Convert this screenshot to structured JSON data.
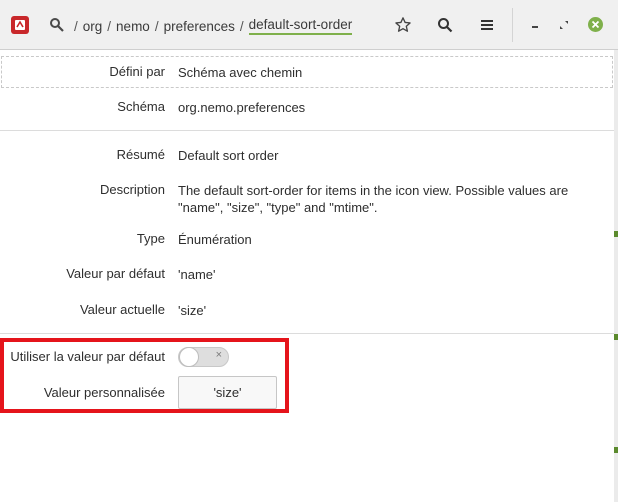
{
  "header": {
    "breadcrumbs": [
      "org",
      "nemo",
      "preferences"
    ],
    "current": "default-sort-order",
    "separator": "/",
    "accent_color": "#7fb04b"
  },
  "icons": {
    "app": "dconf-editor-icon",
    "path": "key-path-icon",
    "bookmark": "star-outline-icon",
    "search": "search-icon",
    "menu": "hamburger-menu-icon",
    "minimize": "minimize-icon",
    "restore": "restore-icon",
    "close": "close-icon"
  },
  "details": {
    "defined_by": {
      "label": "Défini par",
      "value": "Schéma avec chemin"
    },
    "schema": {
      "label": "Schéma",
      "value": "org.nemo.preferences"
    },
    "summary": {
      "label": "Résumé",
      "value": "Default sort order"
    },
    "description": {
      "label": "Description",
      "value": "The default sort-order for items in the icon view. Possible values are \"name\", \"size\", \"type\" and \"mtime\"."
    },
    "type": {
      "label": "Type",
      "value": "Énumération"
    },
    "default_value": {
      "label": "Valeur par défaut",
      "value": "'name'"
    },
    "current_value": {
      "label": "Valeur actuelle",
      "value": "'size'"
    }
  },
  "settings": {
    "use_default": {
      "label": "Utiliser la valeur par défaut",
      "enabled": false,
      "off_glyph": "×"
    },
    "custom_value": {
      "label": "Valeur personnalisée",
      "value": "'size'"
    }
  },
  "colors": {
    "highlight": "#e5141b",
    "app_icon": "#c8272a"
  }
}
